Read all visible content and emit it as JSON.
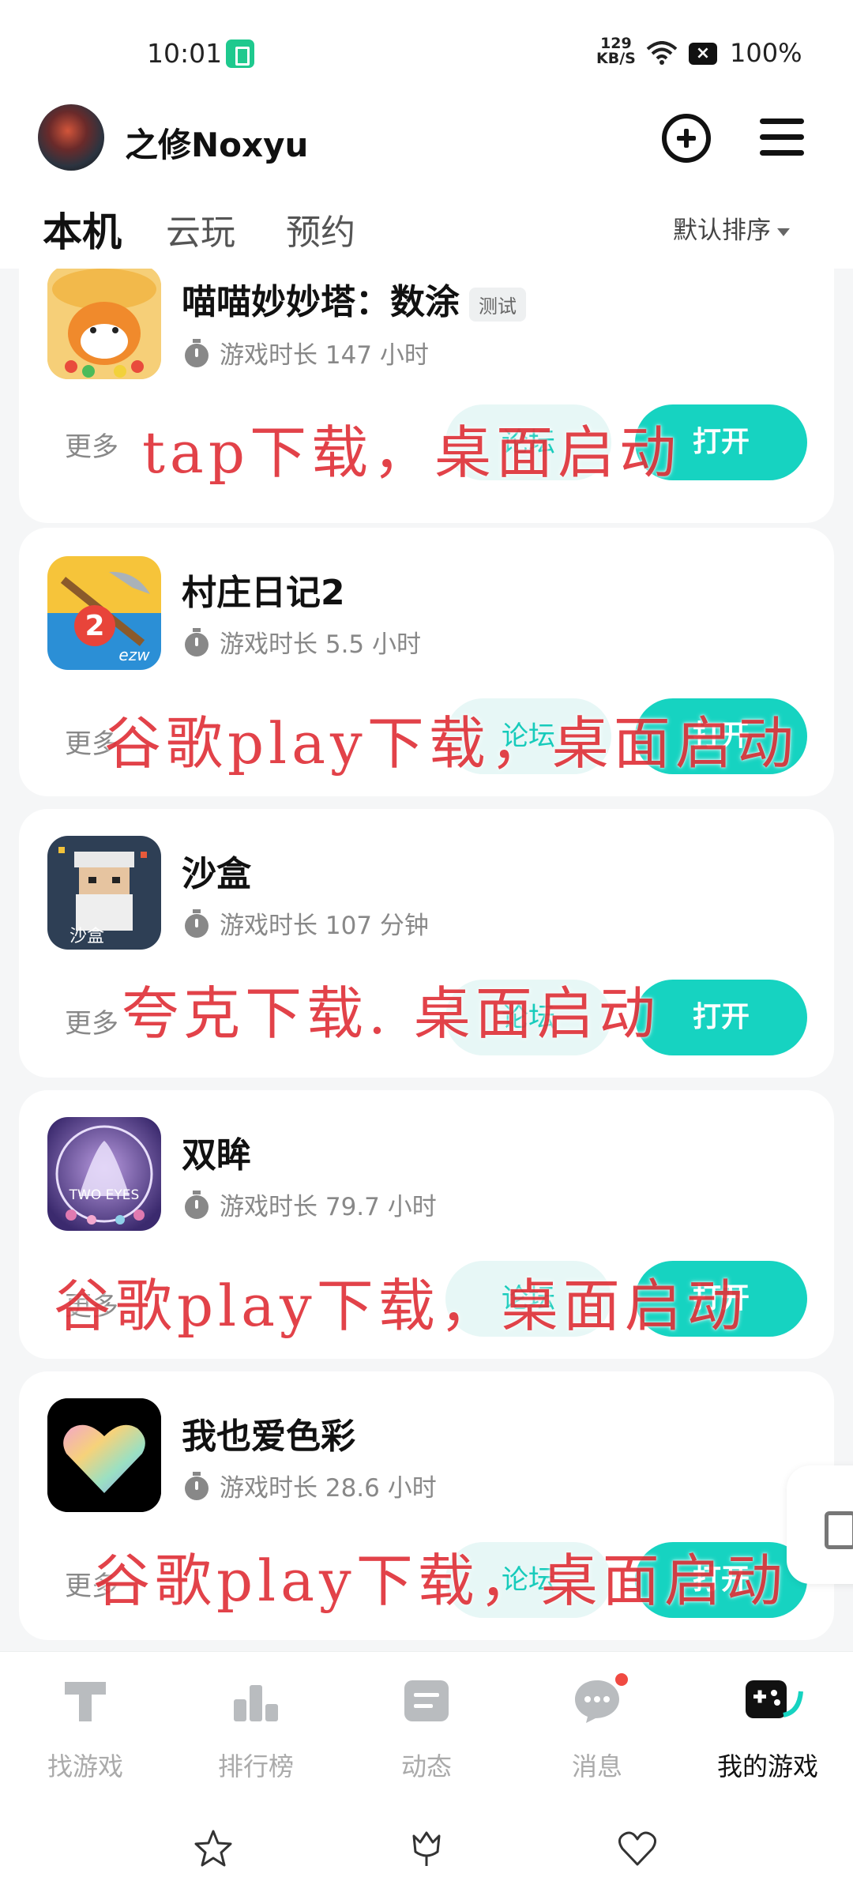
{
  "status_bar": {
    "time": "10:01",
    "net_speed_value": "129",
    "net_speed_unit": "KB/S",
    "battery": "100%"
  },
  "header": {
    "username": "之修Noxyu",
    "tabs": [
      "本机",
      "云玩",
      "预约"
    ],
    "active_tab": 0,
    "sort_label": "默认排序"
  },
  "games": [
    {
      "title": "喵喵妙妙塔：数涂",
      "tag": "测试",
      "playtime": "游戏时长 147 小时",
      "more": "更多",
      "forum": "论坛",
      "open": "打开",
      "overlay": "tap下载，桌面启动",
      "icon": "orange-cat-icon"
    },
    {
      "title": "村庄日记2",
      "playtime": "游戏时长 5.5 小时",
      "more": "更多",
      "forum": "论坛",
      "open": "打开",
      "overlay": "谷歌play下载，桌面启动",
      "icon": "wheat-hammer-icon"
    },
    {
      "title": "沙盒",
      "playtime": "游戏时长 107 分钟",
      "more": "更多",
      "forum": "论坛",
      "open": "打开",
      "overlay": "夸克下载. 桌面启动",
      "icon": "pixel-old-man-icon"
    },
    {
      "title": "双眸",
      "playtime": "游戏时长 79.7 小时",
      "more": "更多",
      "forum": "论坛",
      "open": "打开",
      "overlay": "谷歌play下载，桌面启动",
      "icon": "two-eyes-icon"
    },
    {
      "title": "我也爱色彩",
      "playtime": "游戏时长 28.6 小时",
      "more": "更多",
      "forum": "论坛",
      "open": "打开",
      "overlay": "谷歌play下载，桌面启动",
      "icon": "color-heart-icon"
    }
  ],
  "icon_badge_text": {
    "village": "ezw",
    "sandbox": "沙盒",
    "two_eyes": "TWO EYES"
  },
  "bottom_nav": [
    {
      "label": "找游戏",
      "icon": "find-game-icon"
    },
    {
      "label": "排行榜",
      "icon": "ranking-icon"
    },
    {
      "label": "动态",
      "icon": "feed-icon"
    },
    {
      "label": "消息",
      "icon": "message-icon"
    },
    {
      "label": "我的游戏",
      "icon": "my-games-icon"
    }
  ],
  "colors": {
    "accent": "#16d3c1",
    "accent_light": "#e7f7f6",
    "overlay_red": "#e0333a",
    "badge_red": "#f04a42"
  }
}
